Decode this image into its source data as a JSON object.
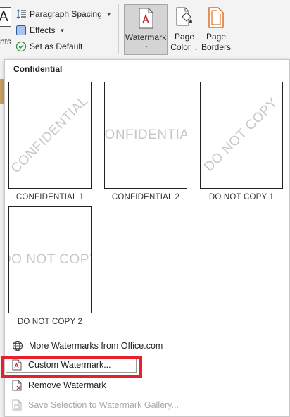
{
  "ribbon": {
    "fonts_label": "nts",
    "fonts_glyph": "A",
    "paragraph_spacing": "Paragraph Spacing",
    "effects": "Effects",
    "set_as_default": "Set as Default",
    "watermark": "Watermark",
    "page_color_line1": "Page",
    "page_color_line2": "Color",
    "page_borders_line1": "Page",
    "page_borders_line2": "Borders"
  },
  "gallery": {
    "section_title": "Confidential",
    "items": [
      {
        "text": "CONFIDENTIAL",
        "caption": "CONFIDENTIAL 1",
        "style": "diagonal"
      },
      {
        "text": "CONFIDENTIAL",
        "caption": "CONFIDENTIAL 2",
        "style": "horizontal"
      },
      {
        "text": "DO NOT COPY",
        "caption": "DO NOT COPY 1",
        "style": "diagonal"
      },
      {
        "text": "DO NOT COPY",
        "caption": "DO NOT COPY 2",
        "style": "horizontal"
      }
    ]
  },
  "menu": {
    "more_watermarks": "More Watermarks from Office.com",
    "custom_watermark": "Custom Watermark...",
    "remove_watermark": "Remove Watermark",
    "save_selection": "Save Selection to Watermark Gallery..."
  },
  "icons": {
    "globe": "globe-icon",
    "custom": "custom-watermark-icon",
    "remove": "remove-watermark-icon",
    "save": "save-selection-icon"
  },
  "colors": {
    "highlight": "#e8202a",
    "accent_orange": "#e07020",
    "watermark_red": "#c0272d"
  }
}
